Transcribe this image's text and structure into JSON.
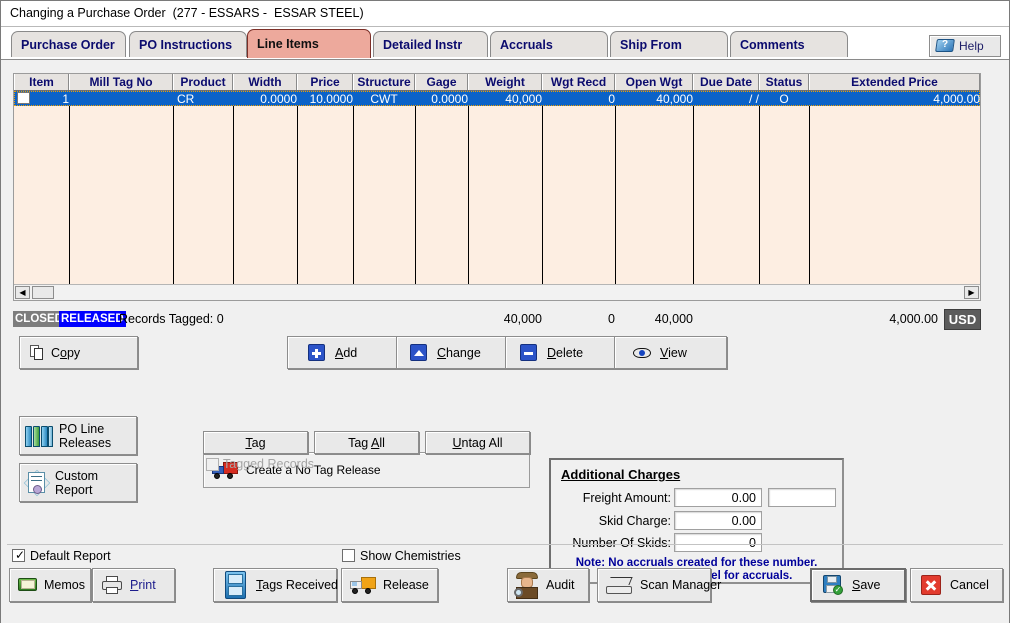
{
  "window": {
    "title": "Changing a Purchase Order  (277 - ESSARS -  ESSAR STEEL)"
  },
  "tabs": [
    {
      "label": "Purchase Order",
      "active": false
    },
    {
      "label": "PO Instructions",
      "active": false
    },
    {
      "label": "Line Items",
      "active": true
    },
    {
      "label": "Detailed Instr",
      "active": false
    },
    {
      "label": "Accruals",
      "active": false
    },
    {
      "label": "Ship From",
      "active": false
    },
    {
      "label": "Comments",
      "active": false
    }
  ],
  "help": {
    "label": "Help",
    "icon": "help-book-icon"
  },
  "grid": {
    "columns": [
      {
        "label": "Item"
      },
      {
        "label": "Mill Tag No"
      },
      {
        "label": "Product"
      },
      {
        "label": "Width"
      },
      {
        "label": "Price"
      },
      {
        "label": "Structure"
      },
      {
        "label": "Gage"
      },
      {
        "label": "Weight"
      },
      {
        "label": "Wgt Recd"
      },
      {
        "label": "Open Wgt"
      },
      {
        "label": "Due Date"
      },
      {
        "label": "Status"
      },
      {
        "label": "Extended Price"
      }
    ],
    "rows": [
      {
        "selected": true,
        "checked": false,
        "item": "1",
        "mill_tag_no": "",
        "product": "CR",
        "width": "0.0000",
        "price": "10.0000",
        "structure": "CWT",
        "gage": "0.0000",
        "weight": "40,000",
        "wgt_recd": "0",
        "open_wgt": "40,000",
        "due_date": "/  /",
        "status": "O",
        "extended_price": "4,000.00"
      }
    ]
  },
  "status": {
    "closed_badge": "CLOSED",
    "released_badge": "RELEASED",
    "records_tagged": "Records Tagged:  0",
    "total_weight": "40,000",
    "total_wgt_recd": "0",
    "total_open_wgt": "40,000",
    "total_extended_price": "4,000.00",
    "currency": "USD"
  },
  "actions": {
    "copy": "Copy",
    "add": "Add",
    "change": "Change",
    "delete": "Delete",
    "view": "View"
  },
  "side": {
    "po_line_releases_line1": "PO Line",
    "po_line_releases_line2": "Releases",
    "custom_report_line1": "Custom",
    "custom_report_line2": "Report"
  },
  "tagging": {
    "create_no_tag_release": "Create a No Tag Release",
    "tag": "Tag",
    "tag_all": "Tag All",
    "untag_all": "Untag All",
    "tagged_records": "Tagged Records",
    "tagged_records_checked": false
  },
  "additional_charges": {
    "title": "Additional Charges",
    "freight_amount_label": "Freight Amount:",
    "freight_amount_value": "0.00",
    "freight_currency_value": "",
    "skid_charge_label": "Skid Charge:",
    "skid_charge_value": "0.00",
    "number_of_skids_label": "Number Of Skids:",
    "number_of_skids_value": "0",
    "note_line1": "Note: No accruals created for these number.",
    "note_line2": "Enter FRT at line level for accruals."
  },
  "bottom": {
    "default_report": "Default Report",
    "default_report_checked": true,
    "show_chemistries": "Show Chemistries",
    "show_chemistries_checked": false,
    "memos": "Memos",
    "print": "Print",
    "tags_received": "Tags Received",
    "release": "Release",
    "audit": "Audit",
    "scan_manager": "Scan Manager",
    "save": "Save",
    "cancel": "Cancel"
  },
  "colors": {
    "tab_active": "#eda99c",
    "tab_text": "#0b0b6e",
    "grid_body": "#fdeee2",
    "row_selected": "#0b62c8",
    "released_badge": "#0000ff",
    "closed_badge": "#7d7d7d",
    "note_text": "#00009a"
  }
}
